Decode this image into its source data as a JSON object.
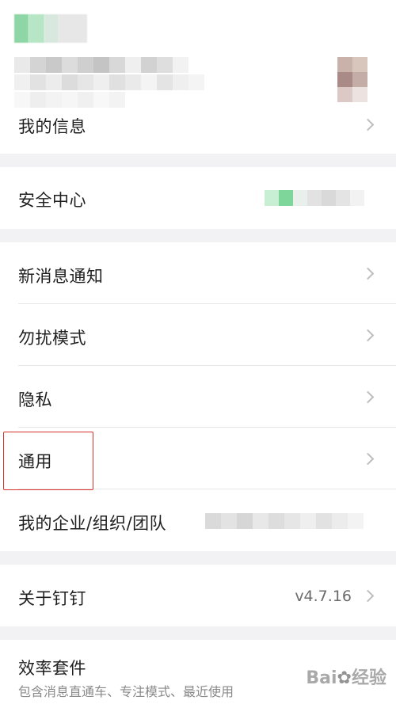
{
  "colors": {
    "background": "#f2f2f4",
    "row": "#ffffff",
    "highlight": "#d9322c",
    "chevron": "#bdbdbd"
  },
  "profile": {
    "my_info_label": "我的信息"
  },
  "security": {
    "label": "安全中心"
  },
  "settings": {
    "notify_label": "新消息通知",
    "dnd_label": "勿扰模式",
    "privacy_label": "隐私",
    "general_label": "通用",
    "enterprise_label": "我的企业/组织/团队"
  },
  "about": {
    "label": "关于钉钉",
    "version": "v4.7.16"
  },
  "suite": {
    "label": "效率套件",
    "sublabel": "包含消息直通车、专注模式、最近使用"
  },
  "watermark": {
    "text": "Bai",
    "suffix": "经验"
  }
}
